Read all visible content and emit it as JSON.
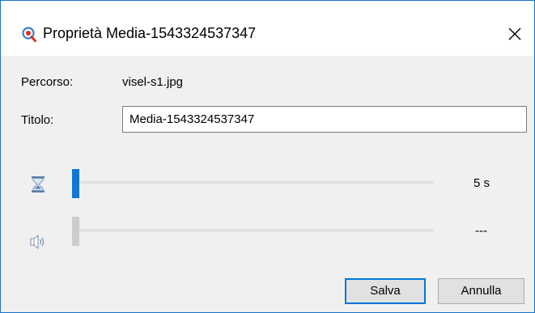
{
  "window": {
    "title": "Proprietà Media-1543324537347",
    "app_icon": "search-magnifier-icon",
    "close_glyph": "×"
  },
  "form": {
    "path_label": "Percorso:",
    "path_value": "visel-s1.jpg",
    "title_label": "Titolo:",
    "title_value": "Media-1543324537347"
  },
  "duration": {
    "icon": "hourglass-icon",
    "value_label": "5 s",
    "level": 0.0
  },
  "volume": {
    "icon": "speaker-icon",
    "value_label": "---",
    "level": 0.0
  },
  "buttons": {
    "save_label": "Salva",
    "cancel_label": "Annulla"
  },
  "colors": {
    "accent": "#0078d7",
    "window_border": "#1a73c7",
    "background": "#f0f0f0"
  }
}
